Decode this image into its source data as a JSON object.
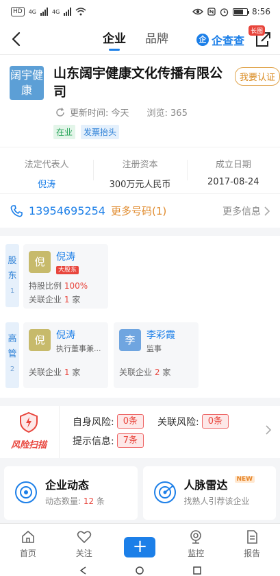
{
  "status_bar": {
    "left_chip": "HD",
    "net1": "4G",
    "net2": "4G",
    "time": "8:56"
  },
  "nav": {
    "tabs": [
      "企业",
      "品牌"
    ],
    "brand_name": "企查查",
    "long_image_badge": "长图"
  },
  "company": {
    "logo_text": "阔宇健康",
    "name": "山东阔宇健康文化传播有限公司",
    "certify_label": "我要认证",
    "update_label": "更新时间: 今天",
    "views_label": "浏览: 365",
    "tags": [
      "在业",
      "发票抬头"
    ]
  },
  "registration": {
    "legal_rep_label": "法定代表人",
    "legal_rep_value": "倪涛",
    "capital_label": "注册资本",
    "capital_value": "300万元人民币",
    "founded_label": "成立日期",
    "founded_value": "2017-08-24"
  },
  "contact": {
    "phone": "13954695254",
    "more_numbers": "更多号码(1)",
    "more_info": "更多信息"
  },
  "shareholders": {
    "side_label_1": "股",
    "side_label_2": "东",
    "count": "1",
    "items": [
      {
        "avatar": "倪",
        "name": "倪涛",
        "badge": "大股东",
        "ratio_label": "持股比例",
        "ratio_value": "100%",
        "related_label": "关联企业",
        "related_count": "1",
        "related_unit": "家"
      }
    ]
  },
  "executives": {
    "side_label_1": "高",
    "side_label_2": "管",
    "count": "2",
    "items": [
      {
        "avatar": "倪",
        "name": "倪涛",
        "role": "执行董事兼...",
        "related_label": "关联企业",
        "related_count": "1",
        "related_unit": "家"
      },
      {
        "avatar": "李",
        "name": "李彩霞",
        "role": "监事",
        "related_label": "关联企业",
        "related_count": "2",
        "related_unit": "家"
      }
    ]
  },
  "risk": {
    "logo_text": "风险扫描",
    "self_risk_label": "自身风险:",
    "self_risk_value": "0条",
    "related_risk_label": "关联风险:",
    "related_risk_value": "0条",
    "notice_label": "提示信息:",
    "notice_value": "7条"
  },
  "dynamics": {
    "news_title": "企业动态",
    "news_sub_label": "动态数量:",
    "news_count": "12",
    "news_unit": "条",
    "radar_title": "人脉雷达",
    "radar_badge": "NEW",
    "radar_sub": "找熟人引荐该企业"
  },
  "tabbar": {
    "home": "首页",
    "follow": "关注",
    "plus": "+",
    "monitor": "监控",
    "report": "报告"
  },
  "colors": {
    "accent": "#1c7fe8",
    "risk_red": "#e8453c",
    "warning_orange": "#e08a2c"
  }
}
